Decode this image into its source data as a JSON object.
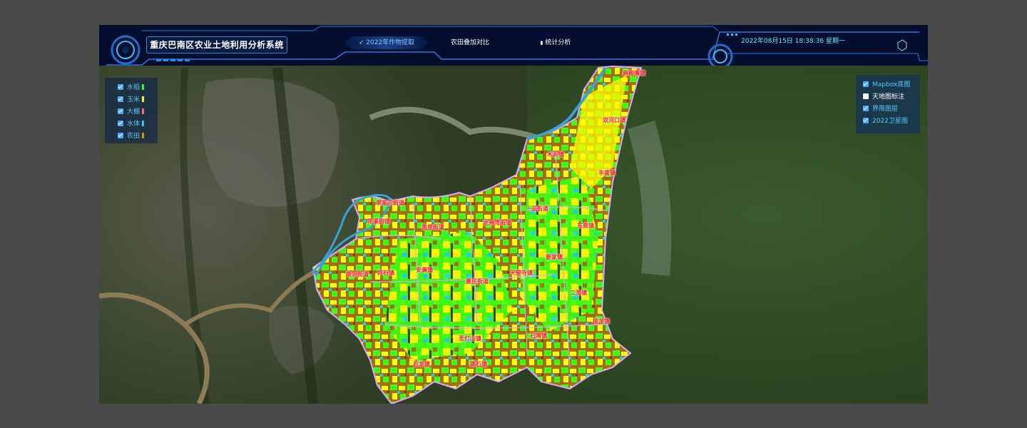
{
  "header": {
    "title": "重庆巴南区农业土地利用分析系统",
    "nav_tabs": [
      {
        "label": "2022年作物提取",
        "active": true
      },
      {
        "label": "农田叠加对比",
        "active": false
      },
      {
        "label": "统计分析",
        "active": false
      }
    ],
    "datetime": "2022年08月15日 18:38:36 星期一"
  },
  "legend": {
    "items": [
      {
        "label": "水稻",
        "color": "#39ff14",
        "checked": true
      },
      {
        "label": "玉米",
        "color": "#ffff00",
        "checked": true
      },
      {
        "label": "大棚",
        "color": "#ff6a6a",
        "checked": true
      },
      {
        "label": "水体",
        "color": "#1ad0ff",
        "checked": true
      },
      {
        "label": "农田",
        "color": "#d98c00",
        "checked": true
      }
    ]
  },
  "layers": {
    "items": [
      {
        "label": "Mapbox底图",
        "checked": true
      },
      {
        "label": "天地图标注",
        "checked": false
      },
      {
        "label": "界限图层",
        "checked": true
      },
      {
        "label": "2022卫星图",
        "checked": true
      }
    ]
  },
  "map": {
    "town_labels": [
      "麻柳嘴镇",
      "双河口镇",
      "木洞镇",
      "丰盛镇",
      "李家沱街道",
      "花溪街道",
      "南泉街道",
      "龙洲湾街道",
      "一品街道",
      "东泉镇",
      "姜家镇",
      "鱼洞街道",
      "界石镇",
      "安澜镇",
      "天星寺镇",
      "惠民街道",
      "二圣镇",
      "接龙镇",
      "石滩镇",
      "石龙镇",
      "圣灯山镇",
      "跳石镇"
    ],
    "colors": {
      "satellite_base": "#2c3a22",
      "boundary": "#d9a6ff",
      "river": "#3aa0d8"
    }
  }
}
